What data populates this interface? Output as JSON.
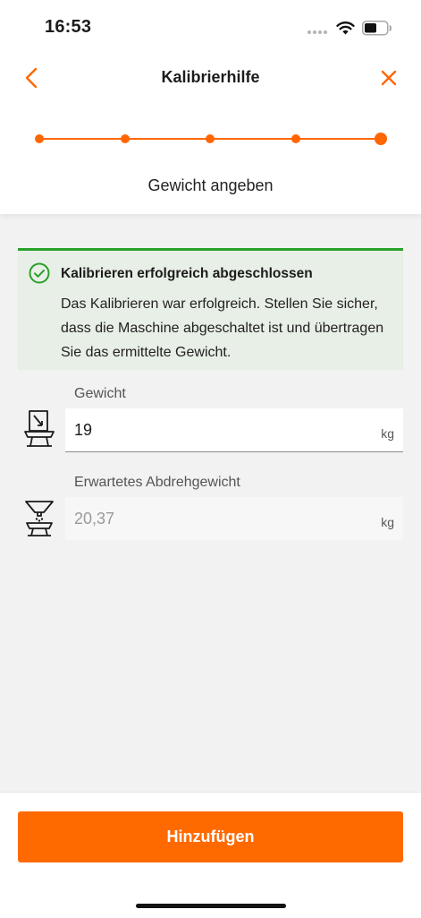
{
  "status_bar": {
    "time": "16:53"
  },
  "header": {
    "title": "Kalibrierhilfe",
    "step_label": "Gewicht angeben",
    "steps_total": 5,
    "current_step": 5,
    "back_icon": "chevron-left-icon",
    "close_icon": "close-icon"
  },
  "success": {
    "icon": "check-circle-icon",
    "title": "Kalibrieren erfolgreich abgeschlossen",
    "message": "Das Kalibrieren war erfolgreich. Stellen Sie sicher, dass die Maschine abgeschaltet ist und übertragen Sie das ermittelte Gewicht."
  },
  "fields": {
    "weight": {
      "label": "Gewicht",
      "value": "19",
      "unit": "kg",
      "icon": "scale-icon"
    },
    "expected": {
      "label": "Erwartetes Abdrehgewicht",
      "value": "20,37",
      "unit": "kg",
      "icon": "hopper-scale-icon"
    }
  },
  "footer": {
    "button_label": "Hinzufügen"
  },
  "colors": {
    "accent": "#ff6a00",
    "success": "#2aa02a",
    "success_bg": "#e8efe6"
  }
}
